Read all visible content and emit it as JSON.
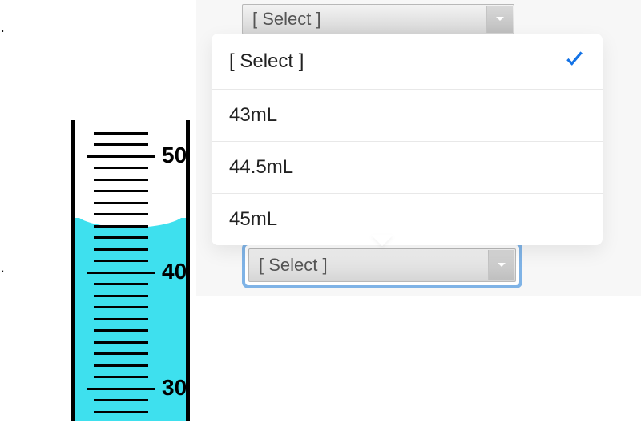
{
  "questions": {
    "q2": {
      "number": "."
    },
    "q3": {
      "number": "."
    }
  },
  "select2": {
    "placeholder": "[ Select ]"
  },
  "select3": {
    "placeholder": "[ Select ]"
  },
  "dropdown": {
    "options": {
      "0": {
        "label": "[ Select ]",
        "selected": true
      },
      "1": {
        "label": "43mL"
      },
      "2": {
        "label": "44.5mL"
      },
      "3": {
        "label": "45mL"
      }
    }
  },
  "cylinder": {
    "labels": {
      "50": "50",
      "40": "40",
      "30": "30"
    },
    "liquid_level_mL": 44.5,
    "visible_range_mL": [
      27,
      53
    ]
  }
}
